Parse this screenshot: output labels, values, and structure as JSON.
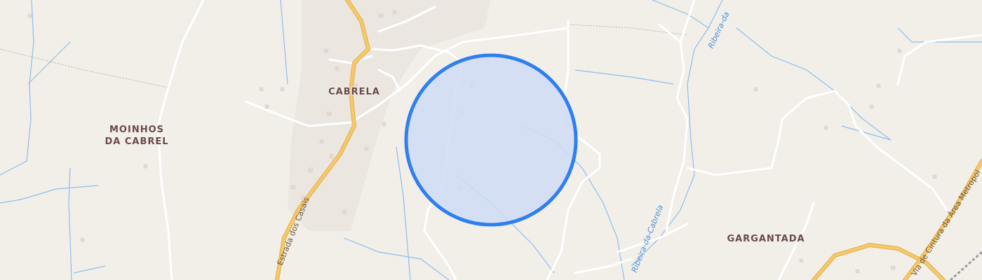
{
  "map": {
    "places": [
      {
        "id": "cabrela",
        "lines": [
          "CABRELA"
        ]
      },
      {
        "id": "moinhos",
        "lines": [
          "MOINHOS",
          "DA CABREL"
        ]
      },
      {
        "id": "gargantada",
        "lines": [
          "GARGANTADA"
        ]
      }
    ],
    "roads": {
      "estrada_dos_casais": "Estrada dos Casais",
      "via_cintura": "Via de Cintura da Área Metropol"
    },
    "streams": {
      "ribeira_cabrela": "Ribeira-da-Cabrela",
      "ribeira_top": "Ribeira-da"
    },
    "colors": {
      "background": "#f2efe9",
      "road_major": "#f7c86a",
      "road_major_casing": "#e0b050",
      "road_minor": "#ffffff",
      "water": "#8fbcee",
      "settlement": "#ebe7e0",
      "building": "#e3d9d3",
      "selection_fill": "#cfdcf4",
      "selection_stroke": "#2f7ff0",
      "label": "#6a4a4a"
    }
  }
}
